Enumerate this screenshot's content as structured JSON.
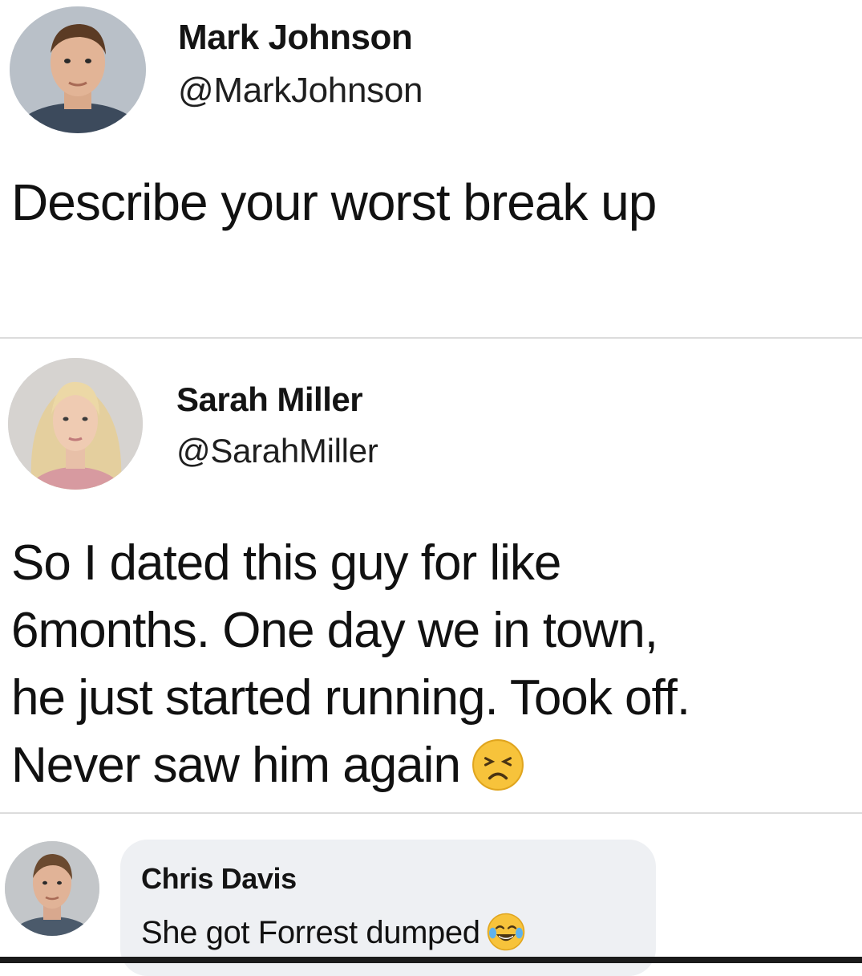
{
  "post": {
    "author": {
      "name": "Mark Johnson",
      "handle": "@MarkJohnson"
    },
    "text": "Describe your worst break up"
  },
  "reply": {
    "author": {
      "name": "Sarah Miller",
      "handle": "@SarahMiller"
    },
    "text": "So I dated this guy for like\n6months. One day we in town,\nhe just started running. Took off.\nNever saw him again",
    "emoji": "persevering-face-icon"
  },
  "comment": {
    "author": {
      "name": "Chris Davis"
    },
    "text": "She got Forrest dumped",
    "emoji": "face-with-tears-of-joy-icon"
  },
  "colors": {
    "background": "#ffffff",
    "divider": "#dcdcdc",
    "bubble": "#eef0f3",
    "text": "#111111"
  }
}
